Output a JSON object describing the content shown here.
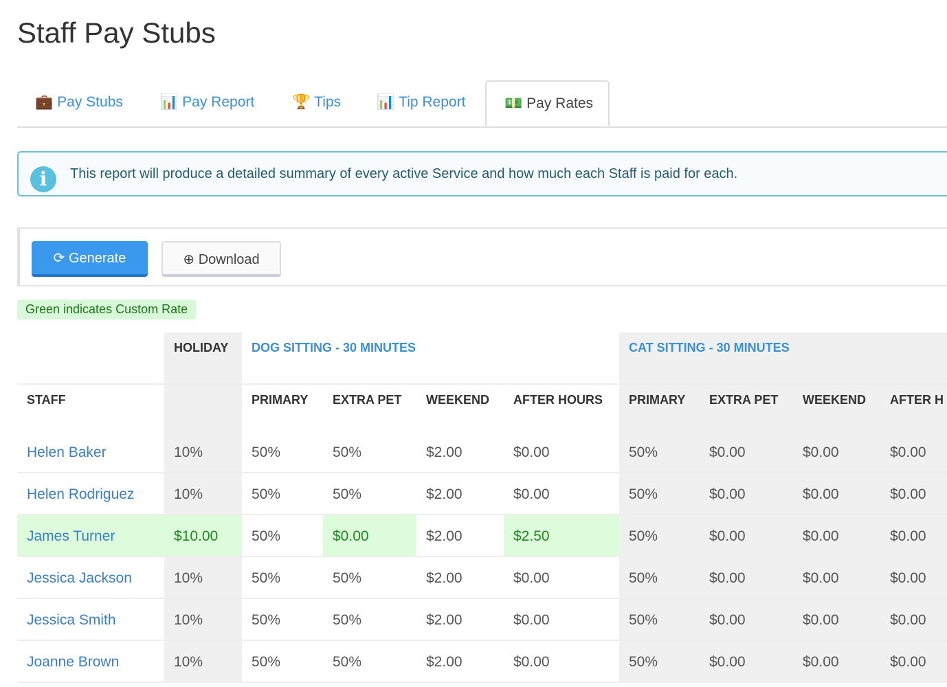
{
  "page_title": "Staff Pay Stubs",
  "tabs": [
    {
      "label": "Pay Stubs",
      "icon": "briefcase-icon"
    },
    {
      "label": "Pay Report",
      "icon": "bar-chart-icon"
    },
    {
      "label": "Tips",
      "icon": "trophy-icon"
    },
    {
      "label": "Tip Report",
      "icon": "bar-chart-icon"
    },
    {
      "label": "Pay Rates",
      "icon": "money-icon",
      "active": true
    }
  ],
  "alert": "This report will produce a detailed summary of every active Service and how much each Staff is paid for each.",
  "toolbar": {
    "generate": "Generate",
    "download": "Download"
  },
  "legend": "Green indicates Custom Rate",
  "colors": {
    "accent": "#3a99ec",
    "custom_rate_bg": "#dcfcdc",
    "custom_rate_text": "#1f8a1f"
  },
  "table": {
    "group_headers": {
      "holiday": "HOLIDAY",
      "dog": "DOG SITTING - 30 MINUTES",
      "cat": "CAT SITTING - 30 MINUTES"
    },
    "columns": [
      "STAFF",
      "PRIMARY",
      "EXTRA PET",
      "WEEKEND",
      "AFTER HOURS",
      "PRIMARY",
      "EXTRA PET",
      "WEEKEND",
      "AFTER H"
    ],
    "rows": [
      {
        "name": "Helen Baker",
        "values": [
          "10%",
          "50%",
          "50%",
          "$2.00",
          "$0.00",
          "50%",
          "$0.00",
          "$0.00",
          "$0.00"
        ],
        "custom": []
      },
      {
        "name": "Helen Rodriguez",
        "values": [
          "10%",
          "50%",
          "50%",
          "$2.00",
          "$0.00",
          "50%",
          "$0.00",
          "$0.00",
          "$0.00"
        ],
        "custom": []
      },
      {
        "name": "James Turner",
        "values": [
          "$10.00",
          "50%",
          "$0.00",
          "$2.00",
          "$2.50",
          "50%",
          "$0.00",
          "$0.00",
          "$0.00"
        ],
        "custom": [
          0,
          2,
          4
        ]
      },
      {
        "name": "Jessica Jackson",
        "values": [
          "10%",
          "50%",
          "50%",
          "$2.00",
          "$0.00",
          "50%",
          "$0.00",
          "$0.00",
          "$0.00"
        ],
        "custom": []
      },
      {
        "name": "Jessica Smith",
        "values": [
          "10%",
          "50%",
          "50%",
          "$2.00",
          "$0.00",
          "50%",
          "$0.00",
          "$0.00",
          "$0.00"
        ],
        "custom": []
      },
      {
        "name": "Joanne Brown",
        "values": [
          "10%",
          "50%",
          "50%",
          "$2.00",
          "$0.00",
          "50%",
          "$0.00",
          "$0.00",
          "$0.00"
        ],
        "custom": []
      }
    ]
  }
}
